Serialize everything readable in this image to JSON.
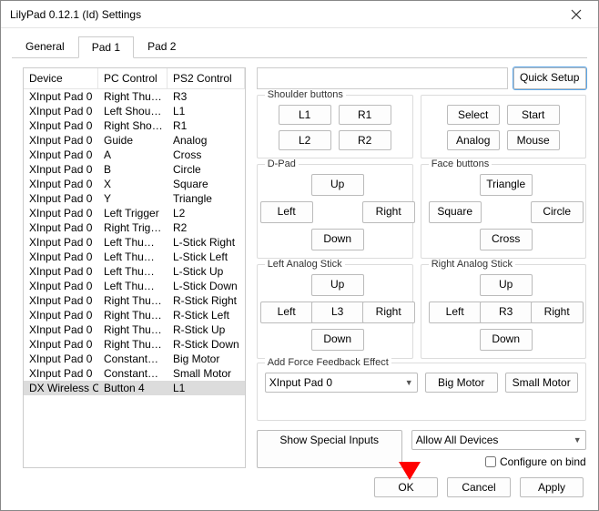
{
  "title": "LilyPad 0.12.1 (Id) Settings",
  "tabs": [
    "General",
    "Pad 1",
    "Pad 2"
  ],
  "activeTab": 1,
  "cols": {
    "device": "Device",
    "pc": "PC Control",
    "ps2": "PS2 Control"
  },
  "rows": [
    {
      "d": "XInput Pad 0",
      "pc": "Right Thu…",
      "ps": "R3"
    },
    {
      "d": "XInput Pad 0",
      "pc": "Left Shou…",
      "ps": "L1"
    },
    {
      "d": "XInput Pad 0",
      "pc": "Right Sho…",
      "ps": "R1"
    },
    {
      "d": "XInput Pad 0",
      "pc": "Guide",
      "ps": "Analog"
    },
    {
      "d": "XInput Pad 0",
      "pc": "A",
      "ps": "Cross"
    },
    {
      "d": "XInput Pad 0",
      "pc": "B",
      "ps": "Circle"
    },
    {
      "d": "XInput Pad 0",
      "pc": "X",
      "ps": "Square"
    },
    {
      "d": "XInput Pad 0",
      "pc": "Y",
      "ps": "Triangle"
    },
    {
      "d": "XInput Pad 0",
      "pc": "Left Trigger",
      "ps": "L2"
    },
    {
      "d": "XInput Pad 0",
      "pc": "Right Trig…",
      "ps": "R2"
    },
    {
      "d": "XInput Pad 0",
      "pc": "Left Thu…",
      "ps": "L-Stick Right"
    },
    {
      "d": "XInput Pad 0",
      "pc": "Left Thu…",
      "ps": "L-Stick Left"
    },
    {
      "d": "XInput Pad 0",
      "pc": "Left Thu…",
      "ps": "L-Stick Up"
    },
    {
      "d": "XInput Pad 0",
      "pc": "Left Thu…",
      "ps": "L-Stick Down"
    },
    {
      "d": "XInput Pad 0",
      "pc": "Right Thu…",
      "ps": "R-Stick Right"
    },
    {
      "d": "XInput Pad 0",
      "pc": "Right Thu…",
      "ps": "R-Stick Left"
    },
    {
      "d": "XInput Pad 0",
      "pc": "Right Thu…",
      "ps": "R-Stick Up"
    },
    {
      "d": "XInput Pad 0",
      "pc": "Right Thu…",
      "ps": "R-Stick Down"
    },
    {
      "d": "XInput Pad 0",
      "pc": "Constant…",
      "ps": "Big Motor"
    },
    {
      "d": "XInput Pad 0",
      "pc": "Constant…",
      "ps": "Small Motor"
    },
    {
      "d": "DX Wireless C…",
      "pc": "Button 4",
      "ps": "L1"
    }
  ],
  "selectedRow": 20,
  "quick": "Quick Setup",
  "groups": {
    "shoulder": "Shoulder buttons",
    "dpad": "D-Pad",
    "face": "Face buttons",
    "la": "Left Analog Stick",
    "ra": "Right Analog Stick",
    "ff": "Add Force Feedback Effect"
  },
  "btns": {
    "L1": "L1",
    "R1": "R1",
    "L2": "L2",
    "R2": "R2",
    "Select": "Select",
    "Start": "Start",
    "Analog": "Analog",
    "Mouse": "Mouse",
    "Up": "Up",
    "Down": "Down",
    "Left": "Left",
    "Right": "Right",
    "Triangle": "Triangle",
    "Square": "Square",
    "Circle": "Circle",
    "Cross": "Cross",
    "L3": "L3",
    "R3": "R3",
    "BigMotor": "Big Motor",
    "SmallMotor": "Small Motor"
  },
  "ffDevice": "XInput Pad 0",
  "specialInputs": "Show Special Inputs",
  "allowDevices": "Allow All Devices",
  "configureOnBind": "Configure on bind",
  "footer": {
    "ok": "OK",
    "cancel": "Cancel",
    "apply": "Apply"
  }
}
